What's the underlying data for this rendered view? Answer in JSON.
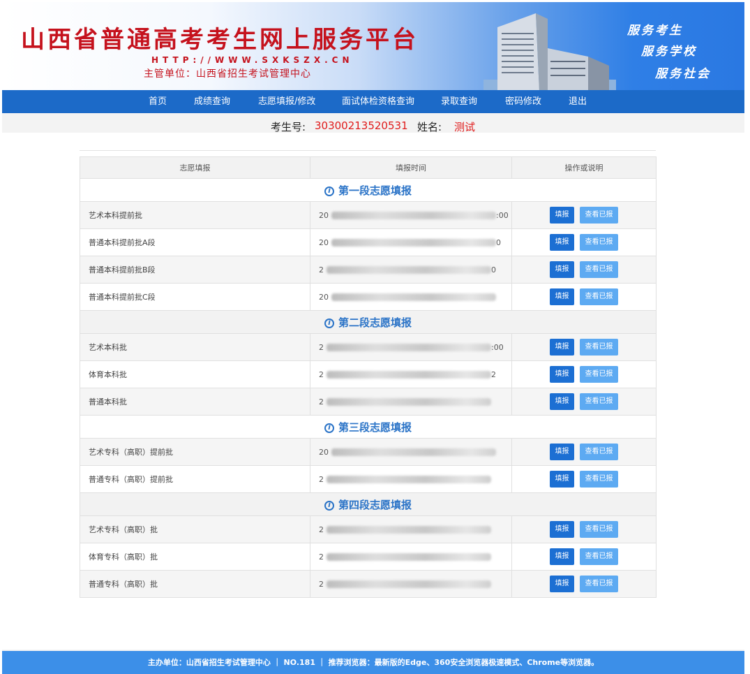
{
  "header": {
    "title": "山西省普通高考考生网上服务平台",
    "url": "HTTP://WWW.SXKSZX.CN",
    "dept": "主管单位：山西省招生考试管理中心",
    "slogans": [
      "服务考生",
      "服务学校",
      "服务社会"
    ]
  },
  "nav": {
    "items": [
      "首页",
      "成绩查询",
      "志愿填报/修改",
      "面试体检资格查询",
      "录取查询",
      "密码修改",
      "退出"
    ]
  },
  "student": {
    "id_label": "考生号:",
    "id_value": "30300213520531",
    "name_label": "姓名:",
    "name_value": "测试"
  },
  "table": {
    "headers": [
      "志愿填报",
      "填报时间",
      "操作或说明"
    ],
    "fill_label": "填报",
    "view_label": "查看已报",
    "sections": [
      {
        "title": "第一段志愿填报",
        "rows": [
          {
            "name": "艺术本科提前批",
            "time_start": "20",
            "time_end": ":00"
          },
          {
            "name": "普通本科提前批A段",
            "time_start": "20",
            "time_end": "0"
          },
          {
            "name": "普通本科提前批B段",
            "time_start": "2",
            "time_end": "0"
          },
          {
            "name": "普通本科提前批C段",
            "time_start": "20",
            "time_end": ""
          }
        ]
      },
      {
        "title": "第二段志愿填报",
        "rows": [
          {
            "name": "艺术本科批",
            "time_start": "2",
            "time_end": ":00"
          },
          {
            "name": "体育本科批",
            "time_start": "2",
            "time_end": "2"
          },
          {
            "name": "普通本科批",
            "time_start": "2",
            "time_end": ""
          }
        ]
      },
      {
        "title": "第三段志愿填报",
        "rows": [
          {
            "name": "艺术专科（高职）提前批",
            "time_start": "20",
            "time_end": ""
          },
          {
            "name": "普通专科（高职）提前批",
            "time_start": "2",
            "time_end": ""
          }
        ]
      },
      {
        "title": "第四段志愿填报",
        "rows": [
          {
            "name": "艺术专科（高职）批",
            "time_start": "2",
            "time_end": ""
          },
          {
            "name": "体育专科（高职）批",
            "time_start": "2",
            "time_end": ""
          },
          {
            "name": "普通专科（高职）批",
            "time_start": "2",
            "time_end": ""
          }
        ]
      }
    ]
  },
  "footer": {
    "text": "主办单位：山西省招生考试管理中心 ｜ NO.181 ｜ 推荐浏览器：最新版的Edge、360安全浏览器极速模式、Chrome等浏览器。"
  },
  "colors": {
    "nav_bg": "#1c6ac8",
    "title_red": "#c5121d",
    "section_blue": "#2a73c7",
    "fill_button": "#1c6fd3",
    "view_button": "#5daaf2",
    "footer_bg": "#3c8fe8"
  }
}
